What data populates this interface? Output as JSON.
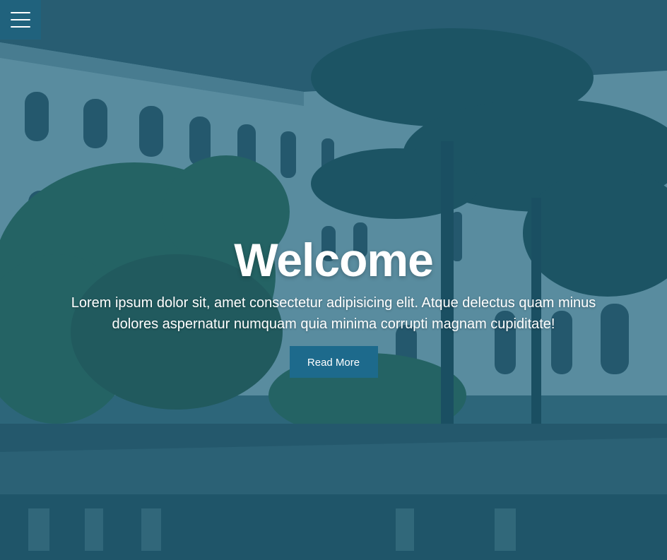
{
  "header": {
    "menu_icon": "hamburger-menu-icon"
  },
  "hero": {
    "title": "Welcome",
    "subtitle": "Lorem ipsum dolor sit, amet consectetur adipisicing elit. Atque delectus quam minus dolores aspernatur numquam quia minima corrupti magnam cupiditate!",
    "button_label": "Read More"
  },
  "colors": {
    "overlay": "#185c78",
    "button": "#1d6a8c",
    "text": "#ffffff"
  }
}
